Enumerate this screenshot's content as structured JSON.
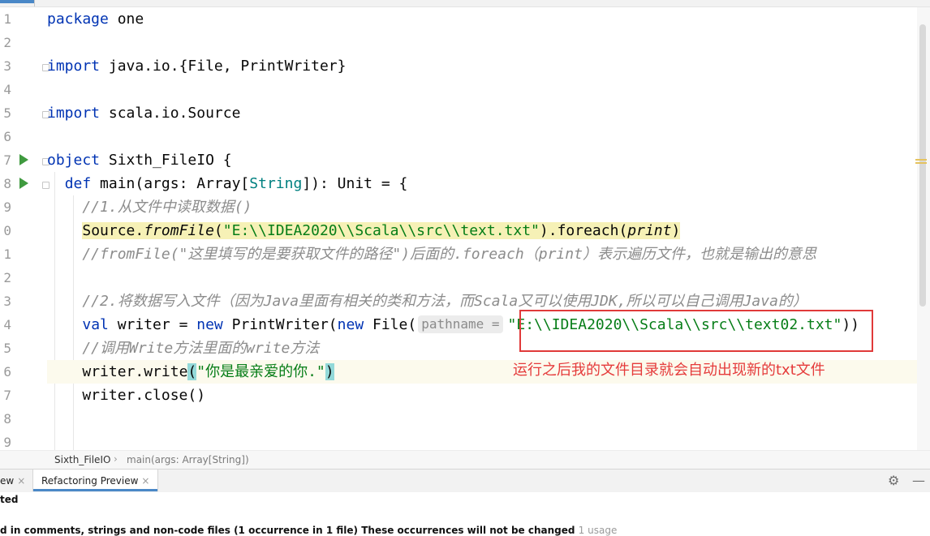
{
  "editor": {
    "line_numbers": [
      "1",
      "2",
      "3",
      "4",
      "5",
      "6",
      "7",
      "8",
      "9",
      "0",
      "1",
      "2",
      "3",
      "4",
      "5",
      "6",
      "7",
      "8",
      "9"
    ],
    "code": {
      "l1_kw": "package",
      "l1_rest": " one",
      "l3_kw": "import",
      "l3_rest": " java.io.{File, PrintWriter}",
      "l5_kw": "import",
      "l5_rest": " scala.io.Source",
      "l7_kw": "object",
      "l7_rest": " Sixth_FileIO {",
      "l8_indent": "  ",
      "l8_kw": "def",
      "l8_a": " main(args: Array[",
      "l8_type": "String",
      "l8_b": "]): Unit = {",
      "l9_comment": "    //1.从文件中读取数据()",
      "l10_indent": "    ",
      "l10_a": "Source.",
      "l10_fn": "fromFile",
      "l10_b": "(",
      "l10_str": "\"E:\\\\IDEA2020\\\\Scala\\\\src\\\\text.txt\"",
      "l10_c": ").foreach(",
      "l10_fn2": "print",
      "l10_d": ")",
      "l11_comment": "    //fromFile(\"这里填写的是要获取文件的路径\")后面的.foreach（print）表示遍历文件，也就是输出的意思",
      "l13_comment": "    //2.将数据写入文件（因为Java里面有相关的类和方法，而Scala又可以使用JDK,所以可以自己调用Java的）",
      "l14_indent": "    ",
      "l14_kw1": "val",
      "l14_a": " writer = ",
      "l14_kw2": "new",
      "l14_b": " PrintWriter(",
      "l14_kw3": "new",
      "l14_c": " File(",
      "l14_hint": "pathname =",
      "l14_str": "\"E:\\\\IDEA2020\\\\Scala\\\\src\\\\text02.txt\"",
      "l14_d": "))",
      "l15_comment": "    //调用Write方法里面的write方法",
      "l16_indent": "    ",
      "l16_a": "writer.write",
      "l16_p1": "(",
      "l16_str": "\"你是最亲爱的你.\"",
      "l16_p2": ")",
      "l17": "    writer.close()"
    },
    "annotation": "运行之后我的文件目录就会自动出现新的txt文件"
  },
  "breadcrumb": {
    "class": "Sixth_FileIO",
    "sep": "›",
    "method": "main(args: Array[String])"
  },
  "toolbar": {
    "tab1_label": "ew",
    "tab2_label": "Refactoring Preview",
    "close": "×"
  },
  "panel": {
    "line1": "ted",
    "line2": "d in comments, strings and non-code files  (1 occurrence in 1 file)  These occurrences will not be changed",
    "line2_count": "1 usage"
  },
  "colors": {
    "keyword": "#0033b3",
    "string": "#067d17",
    "comment": "#8c8c8c",
    "annotation": "#e53b3b",
    "run": "#3f9a3f"
  }
}
